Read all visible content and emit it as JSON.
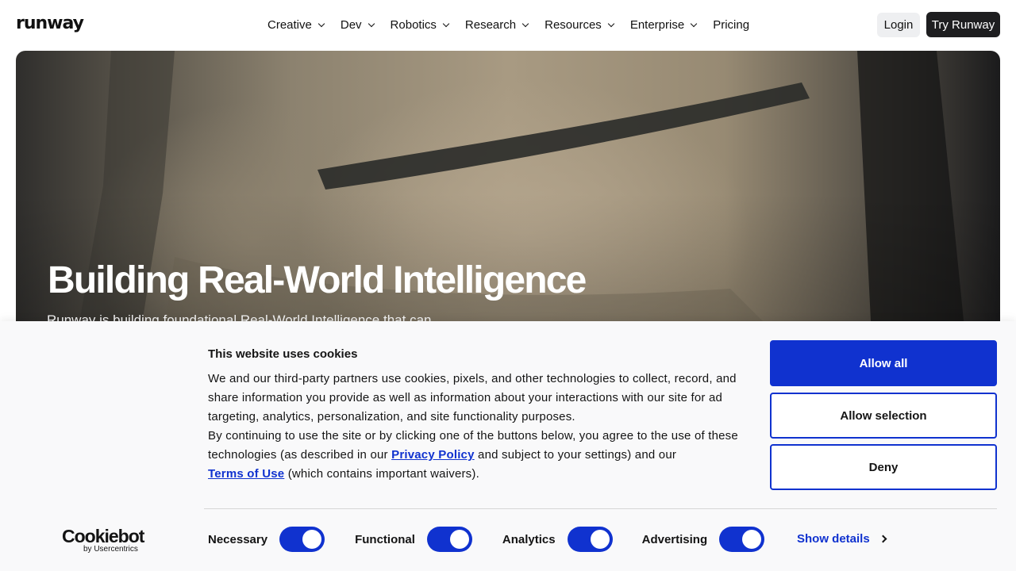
{
  "header": {
    "logo": "runway",
    "nav": [
      {
        "label": "Creative",
        "has_dropdown": true
      },
      {
        "label": "Dev",
        "has_dropdown": true
      },
      {
        "label": "Robotics",
        "has_dropdown": true
      },
      {
        "label": "Research",
        "has_dropdown": true
      },
      {
        "label": "Resources",
        "has_dropdown": true
      },
      {
        "label": "Enterprise",
        "has_dropdown": true
      },
      {
        "label": "Pricing",
        "has_dropdown": false
      }
    ],
    "login_label": "Login",
    "try_label": "Try Runway"
  },
  "hero": {
    "title": "Building Real-World Intelligence",
    "subtitle": "Runway is building foundational Real-World Intelligence that can"
  },
  "cookie_banner": {
    "title": "This website uses cookies",
    "body_p1": "We and our third-party partners use cookies, pixels, and other technologies to collect, record, and share information you provide as well as information about your interactions with our site for ad targeting, analytics, personalization, and site functionality purposes.",
    "body_p2_a": "By continuing to use the site or by clicking one of the buttons below, you agree to the use of these technologies (as described in our ",
    "privacy_link": "Privacy Policy",
    "body_p2_b": " and subject to your settings) and our ",
    "terms_link": "Terms of Use",
    "body_p2_c": " (which contains important waivers).",
    "allow_all": "Allow all",
    "allow_selection": "Allow selection",
    "deny": "Deny",
    "toggles": [
      {
        "label": "Necessary",
        "checked": true
      },
      {
        "label": "Functional",
        "checked": true
      },
      {
        "label": "Analytics",
        "checked": true
      },
      {
        "label": "Advertising",
        "checked": true
      }
    ],
    "show_details": "Show details",
    "brand": "Cookiebot",
    "brand_sub": "by Usercentrics",
    "accent_color": "#1032cf"
  }
}
